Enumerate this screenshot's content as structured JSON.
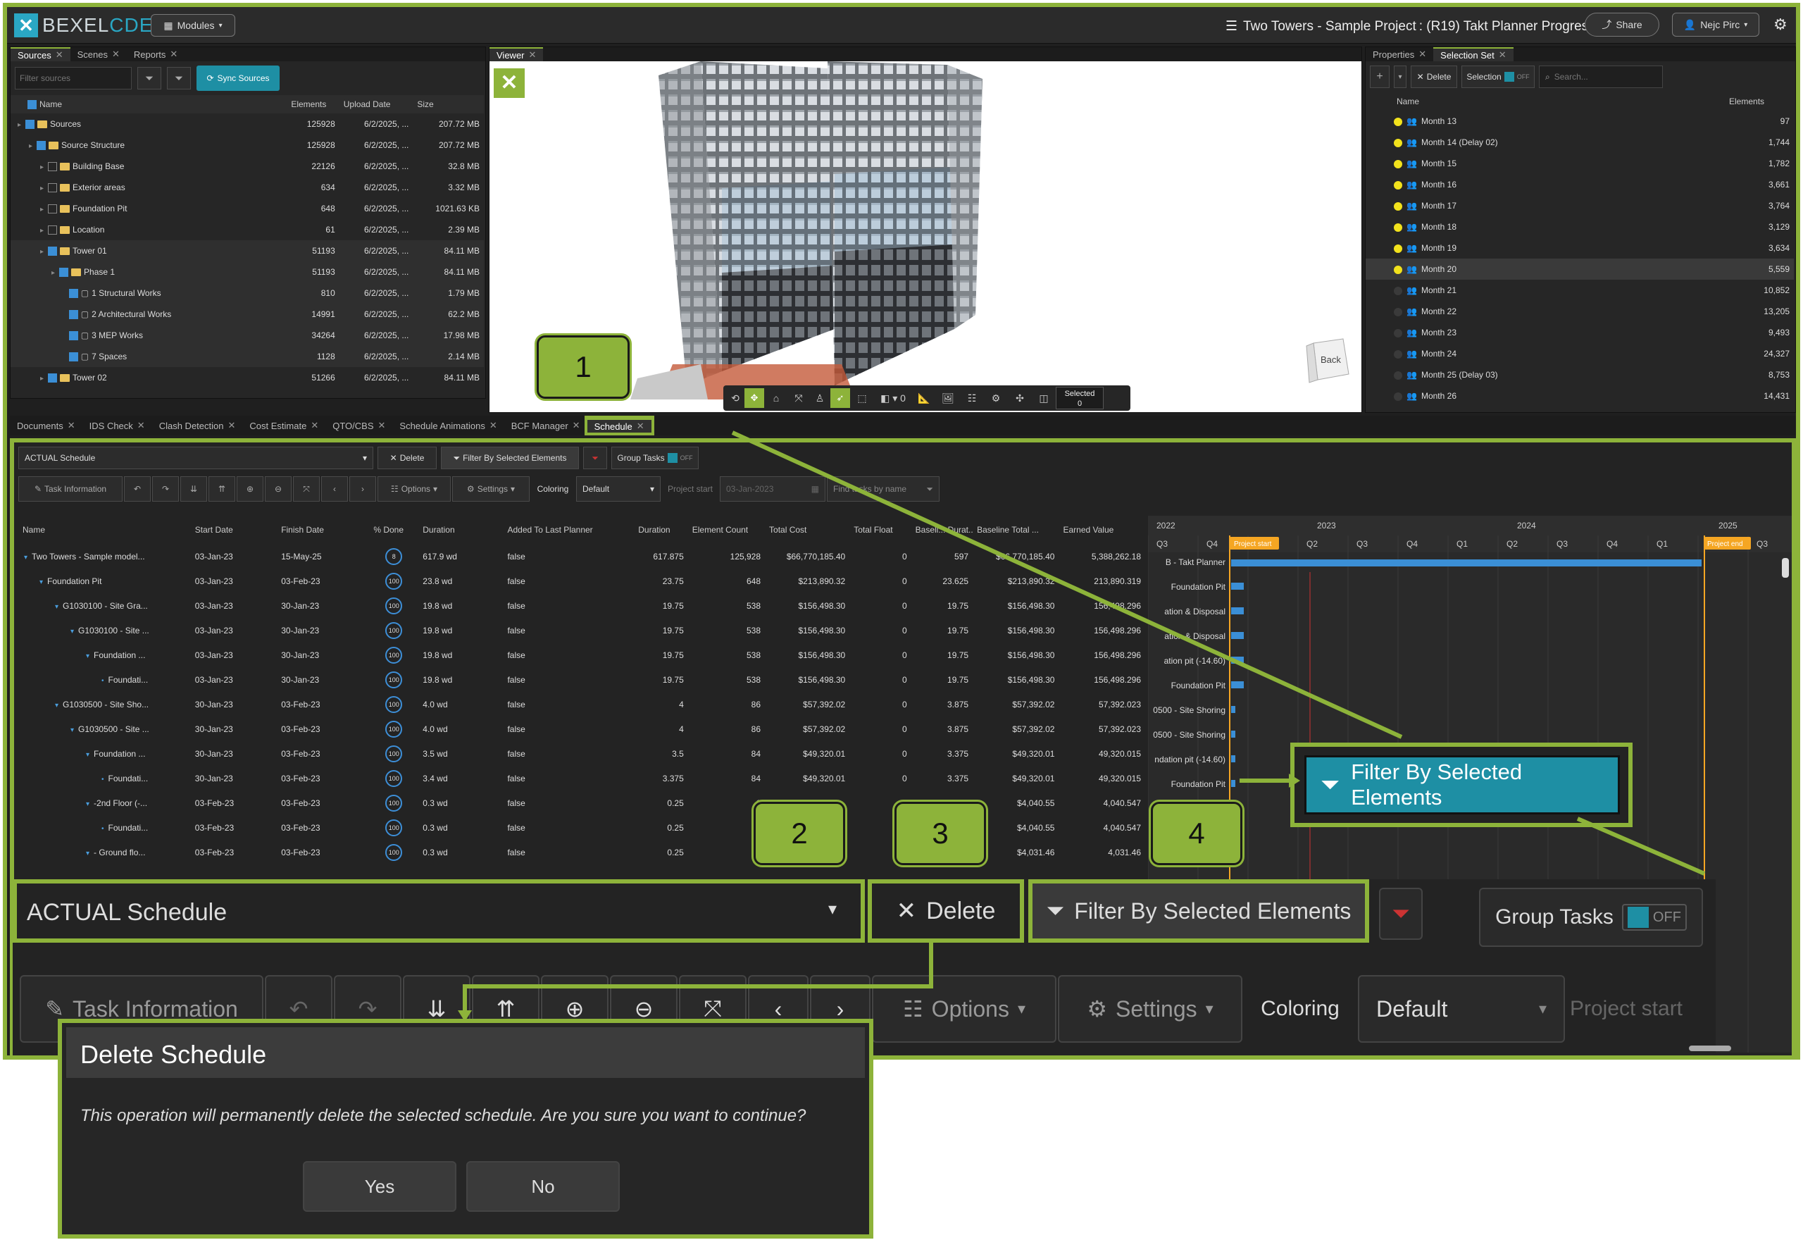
{
  "header": {
    "logo_a": "BEXEL",
    "logo_b": "CDE",
    "modules_label": "Modules",
    "project_title": "Two Towers - Sample Project",
    "project_sub": ": (R19) Takt Planner Progress",
    "share_label": "Share",
    "user_label": "Nejc Pirc"
  },
  "left_panel": {
    "tabs": [
      "Sources",
      "Scenes",
      "Reports"
    ],
    "filter_placeholder": "Filter sources",
    "sync_label": "Sync Sources",
    "columns": [
      "Name",
      "Elements",
      "Upload Date",
      "Size"
    ],
    "rows": [
      {
        "name": "Sources",
        "elements": "125928",
        "date": "6/2/2025, ...",
        "size": "207.72 MB",
        "indent": 0
      },
      {
        "name": "Source Structure",
        "elements": "125928",
        "date": "6/2/2025, ...",
        "size": "207.72 MB",
        "indent": 1
      },
      {
        "name": "Building Base",
        "elements": "22126",
        "date": "6/2/2025, ...",
        "size": "32.8 MB",
        "indent": 2
      },
      {
        "name": "Exterior areas",
        "elements": "634",
        "date": "6/2/2025, ...",
        "size": "3.32 MB",
        "indent": 2
      },
      {
        "name": "Foundation Pit",
        "elements": "648",
        "date": "6/2/2025, ...",
        "size": "1021.63 KB",
        "indent": 2
      },
      {
        "name": "Location",
        "elements": "61",
        "date": "6/2/2025, ...",
        "size": "2.39 MB",
        "indent": 2
      },
      {
        "name": "Tower 01",
        "elements": "51193",
        "date": "6/2/2025, ...",
        "size": "84.11 MB",
        "indent": 2
      },
      {
        "name": "Phase 1",
        "elements": "51193",
        "date": "6/2/2025, ...",
        "size": "84.11 MB",
        "indent": 3
      },
      {
        "name": "1 Structural Works",
        "elements": "810",
        "date": "6/2/2025, ...",
        "size": "1.79 MB",
        "indent": 4
      },
      {
        "name": "2 Architectural Works",
        "elements": "14991",
        "date": "6/2/2025, ...",
        "size": "62.2 MB",
        "indent": 4
      },
      {
        "name": "3 MEP Works",
        "elements": "34264",
        "date": "6/2/2025, ...",
        "size": "17.98 MB",
        "indent": 4
      },
      {
        "name": "7 Spaces",
        "elements": "1128",
        "date": "6/2/2025, ...",
        "size": "2.14 MB",
        "indent": 4
      },
      {
        "name": "Tower 02",
        "elements": "51266",
        "date": "6/2/2025, ...",
        "size": "84.11 MB",
        "indent": 2
      }
    ]
  },
  "viewer": {
    "tab": "Viewer",
    "selected_label": "Selected",
    "selected_value": "0",
    "cube_label": "Back",
    "tool_count": "0"
  },
  "right_panel": {
    "tabs": [
      "Properties",
      "Selection Set"
    ],
    "delete_label": "Delete",
    "selection_label": "Selection",
    "toggle_off": "OFF",
    "search_placeholder": "Search...",
    "columns": [
      "Name",
      "Elements"
    ],
    "rows": [
      {
        "name": "Month 13",
        "count": "97",
        "on": true
      },
      {
        "name": "Month 14 (Delay 02)",
        "count": "1,744",
        "on": true
      },
      {
        "name": "Month 15",
        "count": "1,782",
        "on": true
      },
      {
        "name": "Month 16",
        "count": "3,661",
        "on": true
      },
      {
        "name": "Month 17",
        "count": "3,764",
        "on": true
      },
      {
        "name": "Month 18",
        "count": "3,129",
        "on": true
      },
      {
        "name": "Month 19",
        "count": "3,634",
        "on": true
      },
      {
        "name": "Month 20",
        "count": "5,559",
        "on": true
      },
      {
        "name": "Month 21",
        "count": "10,852",
        "on": false
      },
      {
        "name": "Month 22",
        "count": "13,205",
        "on": false
      },
      {
        "name": "Month 23",
        "count": "9,493",
        "on": false
      },
      {
        "name": "Month 24",
        "count": "24,327",
        "on": false
      },
      {
        "name": "Month 25 (Delay 03)",
        "count": "8,753",
        "on": false
      },
      {
        "name": "Month 26",
        "count": "14,431",
        "on": false
      }
    ]
  },
  "bottom_tabs": [
    "Documents",
    "IDS Check",
    "Clash Detection",
    "Cost Estimate",
    "QTO/CBS",
    "Schedule Animations",
    "BCF Manager",
    "Schedule"
  ],
  "schedule": {
    "schedule_name": "ACTUAL Schedule",
    "delete_label": "Delete",
    "filter_label": "Filter By Selected Elements",
    "group_label": "Group Tasks",
    "toggle_off": "OFF",
    "task_info": "Task Information",
    "options": "Options",
    "settings": "Settings",
    "coloring": "Coloring",
    "coloring_value": "Default",
    "project_start": "Project start",
    "project_start_value": "03-Jan-2023",
    "find_placeholder": "Find tasks by name",
    "columns": [
      "Name",
      "Start Date",
      "Finish Date",
      "% Done",
      "Duration",
      "Added To Last Planner",
      "Duration",
      "Element Count",
      "Total Cost",
      "Total Float",
      "Baseli... Durat...",
      "Baseline Total ...",
      "Earned Value"
    ],
    "rows": [
      {
        "name": "Two Towers - Sample model...",
        "start": "03-Jan-23",
        "finish": "15-May-25",
        "pct": "8",
        "dur": "617.9 wd",
        "added": "false",
        "d2": "617.875",
        "count": "125,928",
        "cost": "$66,770,185.40",
        "float": "0",
        "bdur": "597",
        "btot": "$66,770,185.40",
        "earned": "5,388,262.18",
        "indent": 0
      },
      {
        "name": "Foundation Pit",
        "start": "03-Jan-23",
        "finish": "03-Feb-23",
        "pct": "100",
        "dur": "23.8 wd",
        "added": "false",
        "d2": "23.75",
        "count": "648",
        "cost": "$213,890.32",
        "float": "0",
        "bdur": "23.625",
        "btot": "$213,890.32",
        "earned": "213,890.319",
        "indent": 1
      },
      {
        "name": "G1030100 - Site Gra...",
        "start": "03-Jan-23",
        "finish": "30-Jan-23",
        "pct": "100",
        "dur": "19.8 wd",
        "added": "false",
        "d2": "19.75",
        "count": "538",
        "cost": "$156,498.30",
        "float": "0",
        "bdur": "19.75",
        "btot": "$156,498.30",
        "earned": "156,498.296",
        "indent": 2
      },
      {
        "name": "G1030100 - Site ...",
        "start": "03-Jan-23",
        "finish": "30-Jan-23",
        "pct": "100",
        "dur": "19.8 wd",
        "added": "false",
        "d2": "19.75",
        "count": "538",
        "cost": "$156,498.30",
        "float": "0",
        "bdur": "19.75",
        "btot": "$156,498.30",
        "earned": "156,498.296",
        "indent": 3
      },
      {
        "name": "Foundation ...",
        "start": "03-Jan-23",
        "finish": "30-Jan-23",
        "pct": "100",
        "dur": "19.8 wd",
        "added": "false",
        "d2": "19.75",
        "count": "538",
        "cost": "$156,498.30",
        "float": "0",
        "bdur": "19.75",
        "btot": "$156,498.30",
        "earned": "156,498.296",
        "indent": 4
      },
      {
        "name": "Foundati...",
        "start": "03-Jan-23",
        "finish": "30-Jan-23",
        "pct": "100",
        "dur": "19.8 wd",
        "added": "false",
        "d2": "19.75",
        "count": "538",
        "cost": "$156,498.30",
        "float": "0",
        "bdur": "19.75",
        "btot": "$156,498.30",
        "earned": "156,498.296",
        "indent": 5
      },
      {
        "name": "G1030500 - Site Sho...",
        "start": "30-Jan-23",
        "finish": "03-Feb-23",
        "pct": "100",
        "dur": "4.0 wd",
        "added": "false",
        "d2": "4",
        "count": "86",
        "cost": "$57,392.02",
        "float": "0",
        "bdur": "3.875",
        "btot": "$57,392.02",
        "earned": "57,392.023",
        "indent": 2
      },
      {
        "name": "G1030500 - Site ...",
        "start": "30-Jan-23",
        "finish": "03-Feb-23",
        "pct": "100",
        "dur": "4.0 wd",
        "added": "false",
        "d2": "4",
        "count": "86",
        "cost": "$57,392.02",
        "float": "0",
        "bdur": "3.875",
        "btot": "$57,392.02",
        "earned": "57,392.023",
        "indent": 3
      },
      {
        "name": "Foundation ...",
        "start": "30-Jan-23",
        "finish": "03-Feb-23",
        "pct": "100",
        "dur": "3.5 wd",
        "added": "false",
        "d2": "3.5",
        "count": "84",
        "cost": "$49,320.01",
        "float": "0",
        "bdur": "3.375",
        "btot": "$49,320.01",
        "earned": "49,320.015",
        "indent": 4
      },
      {
        "name": "Foundati...",
        "start": "30-Jan-23",
        "finish": "03-Feb-23",
        "pct": "100",
        "dur": "3.4 wd",
        "added": "false",
        "d2": "3.375",
        "count": "84",
        "cost": "$49,320.01",
        "float": "0",
        "bdur": "3.375",
        "btot": "$49,320.01",
        "earned": "49,320.015",
        "indent": 5
      },
      {
        "name": "-2nd Floor (-...",
        "start": "03-Feb-23",
        "finish": "03-Feb-23",
        "pct": "100",
        "dur": "0.3 wd",
        "added": "false",
        "d2": "0.25",
        "count": "1",
        "cost": "",
        "float": "",
        "bdur": "",
        "btot": "$4,040.55",
        "earned": "4,040.547",
        "indent": 4
      },
      {
        "name": "Foundati...",
        "start": "03-Feb-23",
        "finish": "03-Feb-23",
        "pct": "100",
        "dur": "0.3 wd",
        "added": "false",
        "d2": "0.25",
        "count": "1",
        "cost": "",
        "float": "",
        "bdur": "",
        "btot": "$4,040.55",
        "earned": "4,040.547",
        "indent": 5
      },
      {
        "name": "- Ground flo...",
        "start": "03-Feb-23",
        "finish": "03-Feb-23",
        "pct": "100",
        "dur": "0.3 wd",
        "added": "false",
        "d2": "0.25",
        "count": "1",
        "cost": "",
        "float": "",
        "bdur": "",
        "btot": "$4,031.46",
        "earned": "4,031.46",
        "indent": 4
      }
    ]
  },
  "gantt": {
    "years": [
      "2022",
      "2023",
      "2024",
      "2025"
    ],
    "quarters": [
      "Q3",
      "Q4",
      "",
      "Q2",
      "Q3",
      "Q4",
      "Q1",
      "Q2",
      "Q3",
      "Q4",
      "Q1",
      "",
      "Q3"
    ],
    "project_start_tag": "Project start",
    "project_end_tag": "Project end",
    "row_labels": [
      "B - Takt Planner",
      "Foundation Pit",
      "ation & Disposal",
      "ation & Disposal",
      "ation pit (-14.60)",
      "Foundation Pit",
      "0500 - Site Shoring",
      "0500 - Site Shoring",
      "ndation pit (-14.60)",
      "Foundation Pit"
    ]
  },
  "callouts": [
    "1",
    "2",
    "3",
    "4"
  ],
  "zoom_filter_label": "Filter By Selected Elements",
  "dialog": {
    "title": "Delete Schedule",
    "message": "This operation will permanently delete the selected schedule. Are you sure you want to continue?",
    "yes": "Yes",
    "no": "No"
  },
  "colors": {
    "accent": "#8db33a",
    "teal": "#1e8fa4",
    "bar": "#3b8fd6",
    "marker": "#f5a623"
  }
}
